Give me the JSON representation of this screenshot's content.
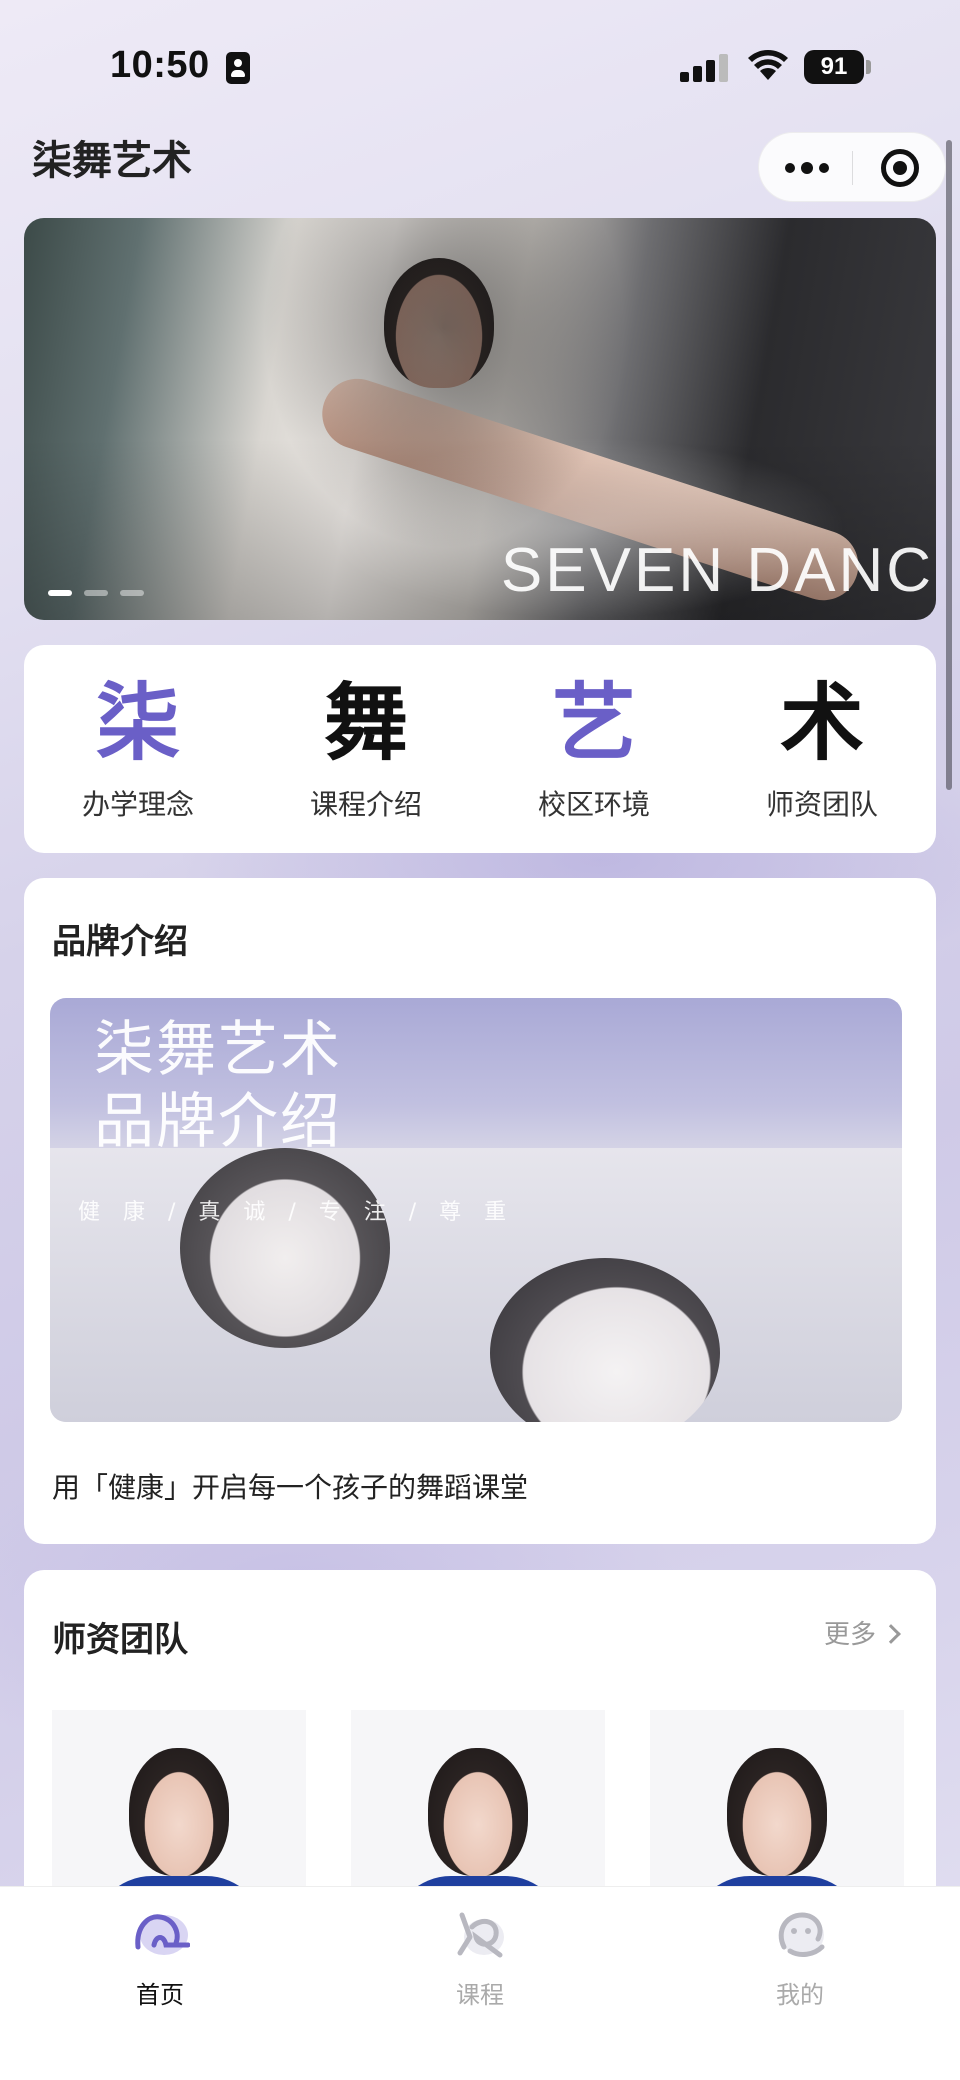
{
  "status_bar": {
    "time": "10:50",
    "battery": "91"
  },
  "header": {
    "title": "柒舞艺术"
  },
  "banner": {
    "caption": "SEVEN DANC",
    "dot_count": 3,
    "active_dot": 0
  },
  "quick_menu": [
    {
      "char": "柒",
      "label": "办学理念"
    },
    {
      "char": "舞",
      "label": "课程介绍"
    },
    {
      "char": "艺",
      "label": "校区环境"
    },
    {
      "char": "术",
      "label": "师资团队"
    }
  ],
  "brand": {
    "section_title": "品牌介绍",
    "image_title_line1": "柒舞艺术",
    "image_title_line2": "品牌介绍",
    "image_subtitle": "健 康 / 真 诚 / 专 注 / 尊 重",
    "description": "用「健康」开启每一个孩子的舞蹈课堂"
  },
  "teachers": {
    "section_title": "师资团队",
    "more_label": "更多",
    "count": 3
  },
  "tab_bar": [
    {
      "label": "首页",
      "icon": "home-icon",
      "active": true
    },
    {
      "label": "课程",
      "icon": "course-icon",
      "active": false
    },
    {
      "label": "我的",
      "icon": "profile-icon",
      "active": false
    }
  ],
  "colors": {
    "accent": "#6a5fc7",
    "teacher_uniform": "#1f3f9f"
  }
}
